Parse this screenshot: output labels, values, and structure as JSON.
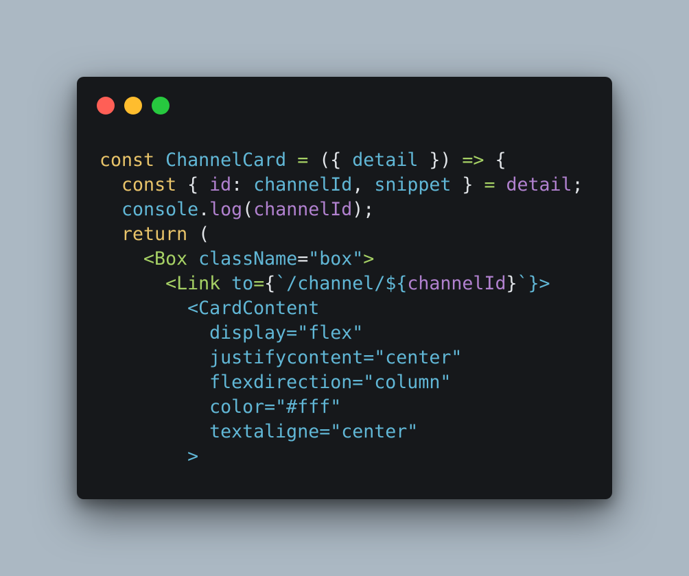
{
  "window": {
    "controls": {
      "close_color": "#ff5f56",
      "minimize_color": "#ffbd2e",
      "maximize_color": "#27c93f"
    }
  },
  "code": {
    "lines": [
      [
        {
          "t": "const",
          "c": "kw"
        },
        {
          "t": " ",
          "c": "pun"
        },
        {
          "t": "ChannelCard",
          "c": "var"
        },
        {
          "t": " ",
          "c": "pun"
        },
        {
          "t": "=",
          "c": "op"
        },
        {
          "t": " ({ ",
          "c": "pun"
        },
        {
          "t": "detail",
          "c": "var"
        },
        {
          "t": " }) ",
          "c": "pun"
        },
        {
          "t": "=>",
          "c": "op"
        },
        {
          "t": " {",
          "c": "pun"
        }
      ],
      [
        {
          "t": "  ",
          "c": "pun"
        },
        {
          "t": "const",
          "c": "kw"
        },
        {
          "t": " { ",
          "c": "pun"
        },
        {
          "t": "id",
          "c": "prp"
        },
        {
          "t": ": ",
          "c": "pun"
        },
        {
          "t": "channelId",
          "c": "var"
        },
        {
          "t": ", ",
          "c": "pun"
        },
        {
          "t": "snippet",
          "c": "var"
        },
        {
          "t": " } ",
          "c": "pun"
        },
        {
          "t": "=",
          "c": "op"
        },
        {
          "t": " ",
          "c": "pun"
        },
        {
          "t": "detail",
          "c": "prp"
        },
        {
          "t": ";",
          "c": "pun"
        }
      ],
      [
        {
          "t": "  ",
          "c": "pun"
        },
        {
          "t": "console",
          "c": "var"
        },
        {
          "t": ".",
          "c": "pun"
        },
        {
          "t": "log",
          "c": "prp"
        },
        {
          "t": "(",
          "c": "pun"
        },
        {
          "t": "channelId",
          "c": "prp"
        },
        {
          "t": ");",
          "c": "pun"
        }
      ],
      [
        {
          "t": "  ",
          "c": "pun"
        },
        {
          "t": "return",
          "c": "kw"
        },
        {
          "t": " (",
          "c": "pun"
        }
      ],
      [
        {
          "t": "    ",
          "c": "pun"
        },
        {
          "t": "<Box",
          "c": "tag"
        },
        {
          "t": " ",
          "c": "pun"
        },
        {
          "t": "className",
          "c": "attr"
        },
        {
          "t": "=",
          "c": "pun"
        },
        {
          "t": "\"box\"",
          "c": "str"
        },
        {
          "t": ">",
          "c": "tag"
        }
      ],
      [
        {
          "t": "      ",
          "c": "pun"
        },
        {
          "t": "<Link",
          "c": "tag"
        },
        {
          "t": " ",
          "c": "pun"
        },
        {
          "t": "to",
          "c": "attr"
        },
        {
          "t": "=",
          "c": "op"
        },
        {
          "t": "{",
          "c": "pun"
        },
        {
          "t": "`/channel/${",
          "c": "str"
        },
        {
          "t": "channelId",
          "c": "prp"
        },
        {
          "t": "}",
          "c": "pun"
        },
        {
          "t": "`",
          "c": "str"
        },
        {
          "t": "}>",
          "c": "tg2"
        }
      ],
      [
        {
          "t": "        ",
          "c": "pun"
        },
        {
          "t": "<CardContent",
          "c": "tg2"
        }
      ],
      [
        {
          "t": "          ",
          "c": "pun"
        },
        {
          "t": "display=\"flex\"",
          "c": "attr"
        }
      ],
      [
        {
          "t": "          ",
          "c": "pun"
        },
        {
          "t": "justifycontent=\"center\"",
          "c": "attr"
        }
      ],
      [
        {
          "t": "          ",
          "c": "pun"
        },
        {
          "t": "flexdirection=\"column\"",
          "c": "attr"
        }
      ],
      [
        {
          "t": "          ",
          "c": "pun"
        },
        {
          "t": "color=\"#fff\"",
          "c": "attr"
        }
      ],
      [
        {
          "t": "          ",
          "c": "pun"
        },
        {
          "t": "textaligne=\"center\"",
          "c": "attr"
        }
      ],
      [
        {
          "t": "        ",
          "c": "pun"
        },
        {
          "t": ">",
          "c": "tg2"
        }
      ]
    ]
  }
}
